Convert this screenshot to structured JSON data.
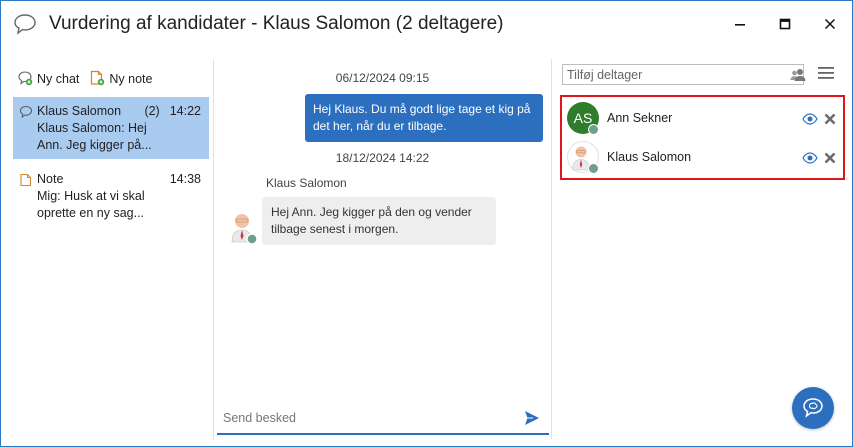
{
  "window": {
    "title": "Vurdering af kandidater - Klaus Salomon (2 deltagere)"
  },
  "left": {
    "new_chat_label": "Ny chat",
    "new_note_label": "Ny note",
    "conversations": [
      {
        "name": "Klaus Salomon",
        "count": "(2)",
        "time": "14:22",
        "preview": "Klaus Salomon: Hej\nAnn. Jeg kigger på...",
        "icon": "chat-bubble-icon",
        "selected": true
      },
      {
        "name": "Note",
        "time": "14:38",
        "preview": "Mig: Husk at vi skal\noprette en ny sag...",
        "icon": "note-icon",
        "selected": false
      }
    ]
  },
  "chat": {
    "date1": "06/12/2024 09:15",
    "outgoing_message": "Hej Klaus. Du må godt lige tage et kig på det her, når du er tilbage.",
    "date2": "18/12/2024 14:22",
    "sender": "Klaus Salomon",
    "incoming_message": "Hej Ann. Jeg kigger på den og vender tilbage senest i morgen.",
    "composer_placeholder": "Send besked"
  },
  "participants": {
    "add_placeholder": "Tilføj deltager",
    "list": [
      {
        "name": "Ann Sekner",
        "initials": "AS"
      },
      {
        "name": "Klaus Salomon",
        "initials": ""
      }
    ]
  },
  "colors": {
    "accent": "#2c6fbe",
    "selected_bg": "#a9cbf0",
    "highlight_border": "#e0141b",
    "avatar_green": "#2f7d2c",
    "status_dot": "#6f9e8a"
  }
}
